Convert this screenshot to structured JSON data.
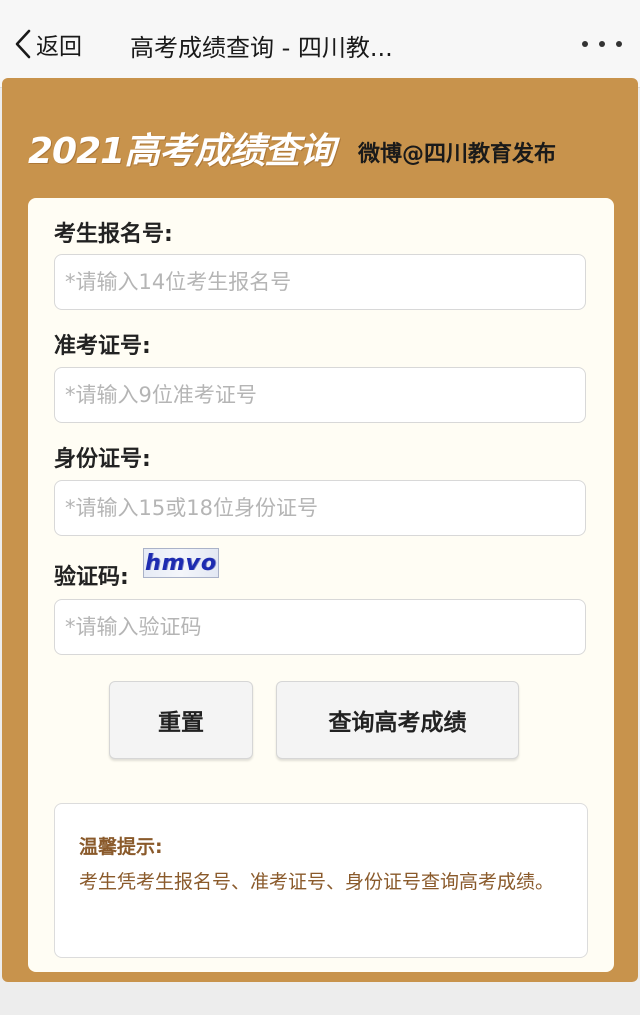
{
  "navbar": {
    "back_label": "返回",
    "title": "高考成绩查询 - 四川教..."
  },
  "banner": {
    "title": "2021高考成绩查询",
    "source": "微博@四川教育发布"
  },
  "form": {
    "registration": {
      "label": "考生报名号:",
      "placeholder": "*请输入14位考生报名号",
      "value": ""
    },
    "admission": {
      "label": "准考证号:",
      "placeholder": "*请输入9位准考证号",
      "value": ""
    },
    "id_card": {
      "label": "身份证号:",
      "placeholder": "*请输入15或18位身份证号",
      "value": ""
    },
    "captcha": {
      "label": "验证码:",
      "image_text": "hmvo",
      "placeholder": "*请输入验证码",
      "value": ""
    }
  },
  "buttons": {
    "reset_label": "重置",
    "query_label": "查询高考成绩"
  },
  "tips": {
    "title": "温馨提示:",
    "text": "考生凭考生报名号、准考证号、身份证号查询高考成绩。"
  },
  "colors": {
    "card_background": "#c8934c",
    "panel_background": "#fffdf4",
    "tips_text": "#8a5a2b"
  },
  "icons": {
    "back": "chevron-left-icon",
    "more": "more-dots-icon"
  }
}
